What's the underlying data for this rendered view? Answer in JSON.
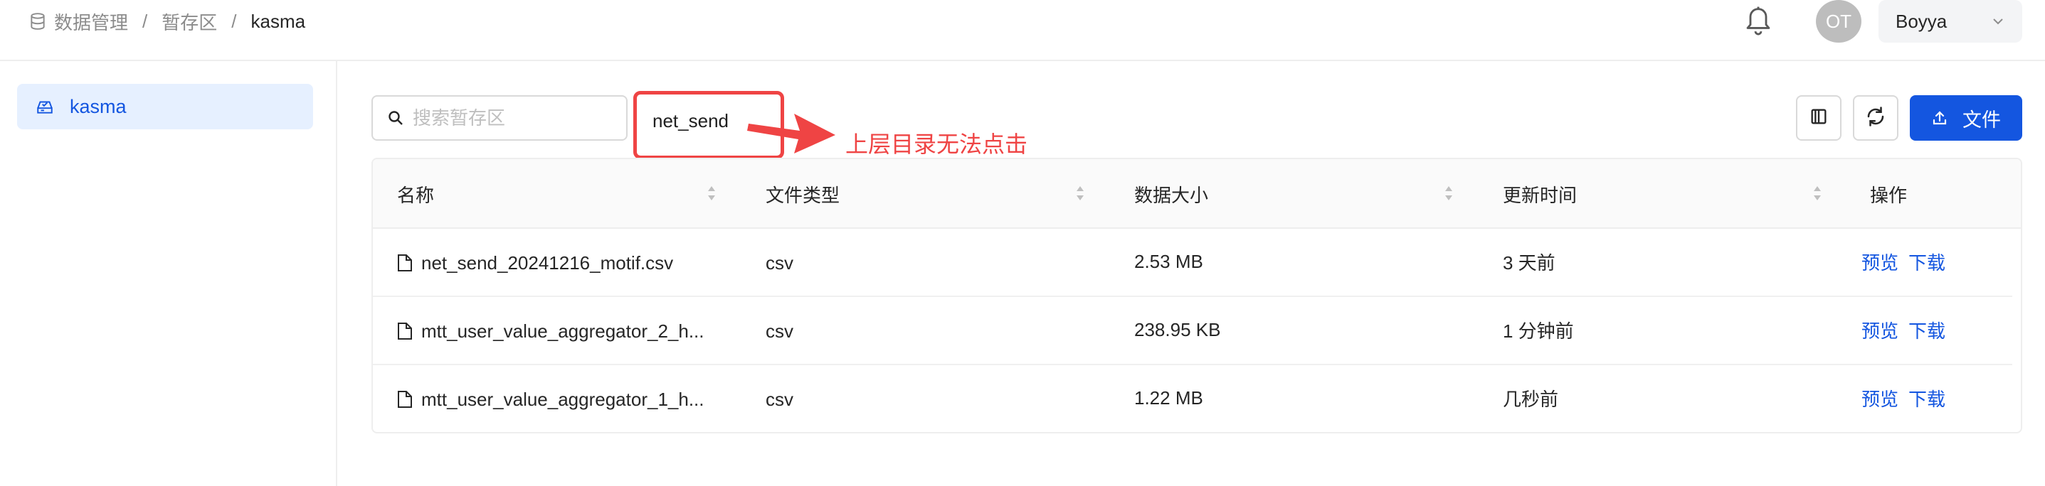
{
  "breadcrumb": {
    "items": [
      "数据管理",
      "暂存区",
      "kasma"
    ],
    "separator": "/"
  },
  "header": {
    "avatar_initials": "OT",
    "user_name": "Boyya"
  },
  "sidebar": {
    "items": [
      {
        "label": "kasma",
        "active": true
      }
    ]
  },
  "toolbar": {
    "search_placeholder": "搜索暂存区",
    "current_path": "net_send",
    "annotation": "上层目录无法点击",
    "upload_label": "文件"
  },
  "table": {
    "columns": [
      "名称",
      "文件类型",
      "数据大小",
      "更新时间",
      "操作"
    ],
    "rows": [
      {
        "name": "net_send_20241216_motif.csv",
        "type": "csv",
        "size": "2.53 MB",
        "updated": "3 天前",
        "actions": [
          "预览",
          "下载"
        ]
      },
      {
        "name": "mtt_user_value_aggregator_2_h...",
        "type": "csv",
        "size": "238.95 KB",
        "updated": "1 分钟前",
        "actions": [
          "预览",
          "下载"
        ]
      },
      {
        "name": "mtt_user_value_aggregator_1_h...",
        "type": "csv",
        "size": "1.22 MB",
        "updated": "几秒前",
        "actions": [
          "预览",
          "下载"
        ]
      }
    ]
  },
  "colors": {
    "primary": "#1456e0",
    "annotation": "#ef4444",
    "active_bg": "#e6f0ff"
  },
  "icons": {
    "breadcrumb": "database-icon",
    "notifications": "bell-icon",
    "sidebar_item": "storage-icon",
    "search": "search-icon",
    "columns": "columns-icon",
    "refresh": "refresh-icon",
    "upload": "upload-icon",
    "file": "file-icon",
    "sort": "sort-icon"
  }
}
